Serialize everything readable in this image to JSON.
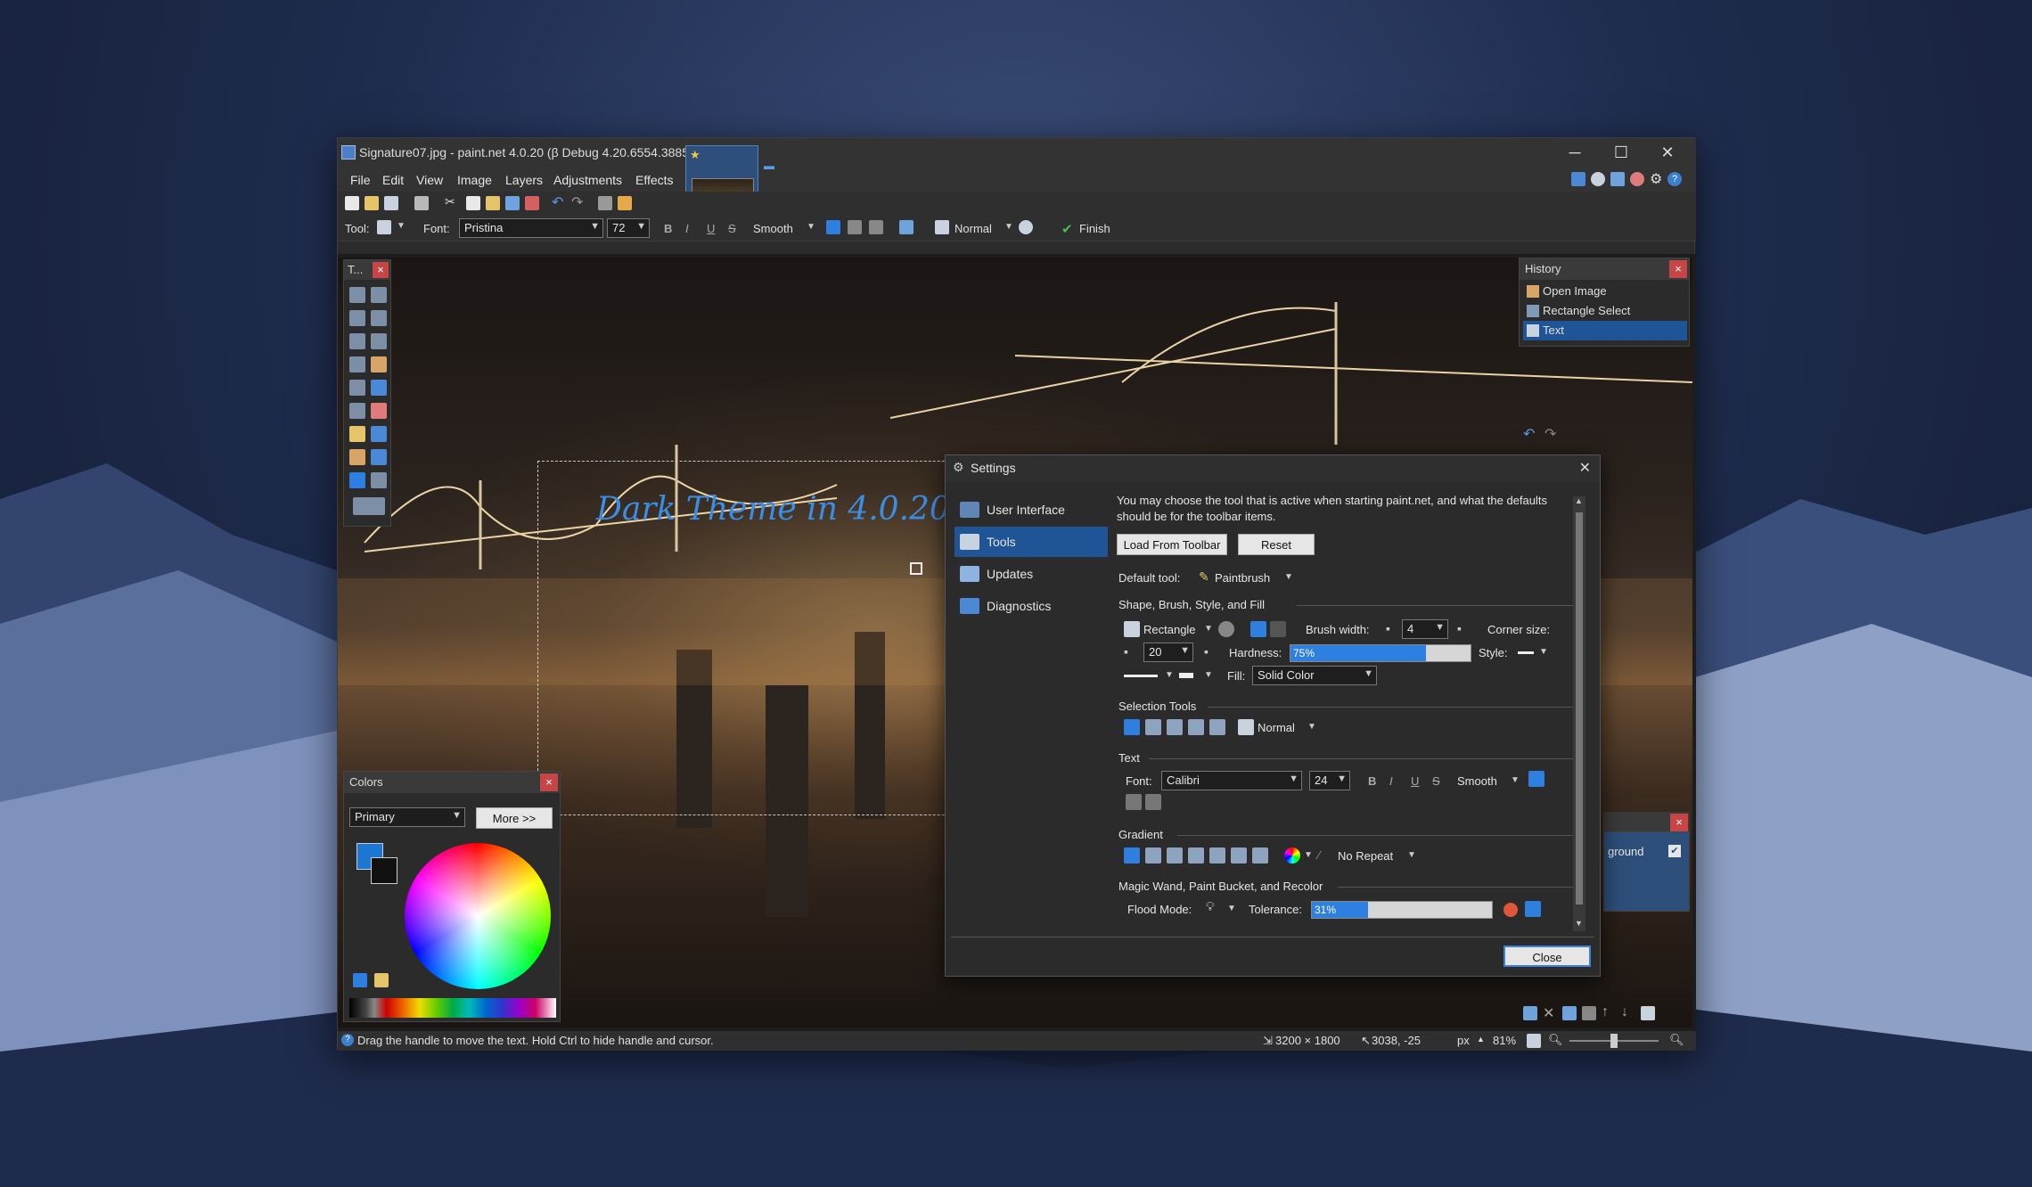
{
  "window": {
    "title": "Signature07.jpg - paint.net 4.0.20 (β Debug 4.20.6554.3885)",
    "controls": [
      "─",
      "☐",
      "✕"
    ]
  },
  "menu": [
    "File",
    "Edit",
    "View",
    "Image",
    "Layers",
    "Adjustments",
    "Effects"
  ],
  "toolbar": {
    "tool_label": "Tool:",
    "font_label": "Font:",
    "font_value": "Pristina",
    "font_size": "72",
    "bold": "B",
    "italic": "I",
    "underline": "U",
    "strike": "S",
    "rendering": "Smooth",
    "blend_mode": "Normal",
    "finish": "Finish"
  },
  "canvas": {
    "text": "Dark Theme in 4.0.20 !"
  },
  "tools_panel": {
    "title": "T..."
  },
  "history": {
    "title": "History",
    "items": [
      "Open Image",
      "Rectangle Select",
      "Text"
    ],
    "selected_index": 2
  },
  "layers": {
    "item_fragment": "ground"
  },
  "colors": {
    "title": "Colors",
    "mode": "Primary",
    "more_button": "More >>",
    "primary_color": "#1a77d4",
    "secondary_color": "#111111"
  },
  "status": {
    "hint": "Drag the handle to move the text. Hold Ctrl to hide handle and cursor.",
    "image_size": "3200 × 1800",
    "cursor_pos": "3038, -25",
    "units": "px",
    "zoom": "81%"
  },
  "settings": {
    "title": "Settings",
    "nav": [
      "User Interface",
      "Tools",
      "Updates",
      "Diagnostics"
    ],
    "nav_selected": 1,
    "description": "You may choose the tool that is active when starting paint.net, and what the defaults should be for the toolbar items.",
    "load_button": "Load From Toolbar",
    "reset_button": "Reset",
    "default_tool_label": "Default tool:",
    "default_tool_value": "Paintbrush",
    "sections": {
      "shape": "Shape, Brush, Style, and Fill",
      "selection": "Selection Tools",
      "text": "Text",
      "gradient": "Gradient",
      "magic": "Magic Wand, Paint Bucket, and Recolor"
    },
    "shape_type": "Rectangle",
    "brush_width_label": "Brush width:",
    "brush_width": "4",
    "corner_size_label": "Corner size:",
    "corner_size": "20",
    "hardness_label": "Hardness:",
    "hardness": "75%",
    "hardness_fraction": 0.75,
    "style_label": "Style:",
    "fill_label": "Fill:",
    "fill_value": "Solid Color",
    "selection_mode": "Normal",
    "text_font_label": "Font:",
    "text_font": "Calibri",
    "text_size": "24",
    "text_bold": "B",
    "text_italic": "I",
    "text_underline": "U",
    "text_strike": "S",
    "text_rendering": "Smooth",
    "gradient_repeat": "No Repeat",
    "flood_mode_label": "Flood Mode:",
    "tolerance_label": "Tolerance:",
    "tolerance": "31%",
    "tolerance_fraction": 0.31,
    "close_button": "Close"
  }
}
